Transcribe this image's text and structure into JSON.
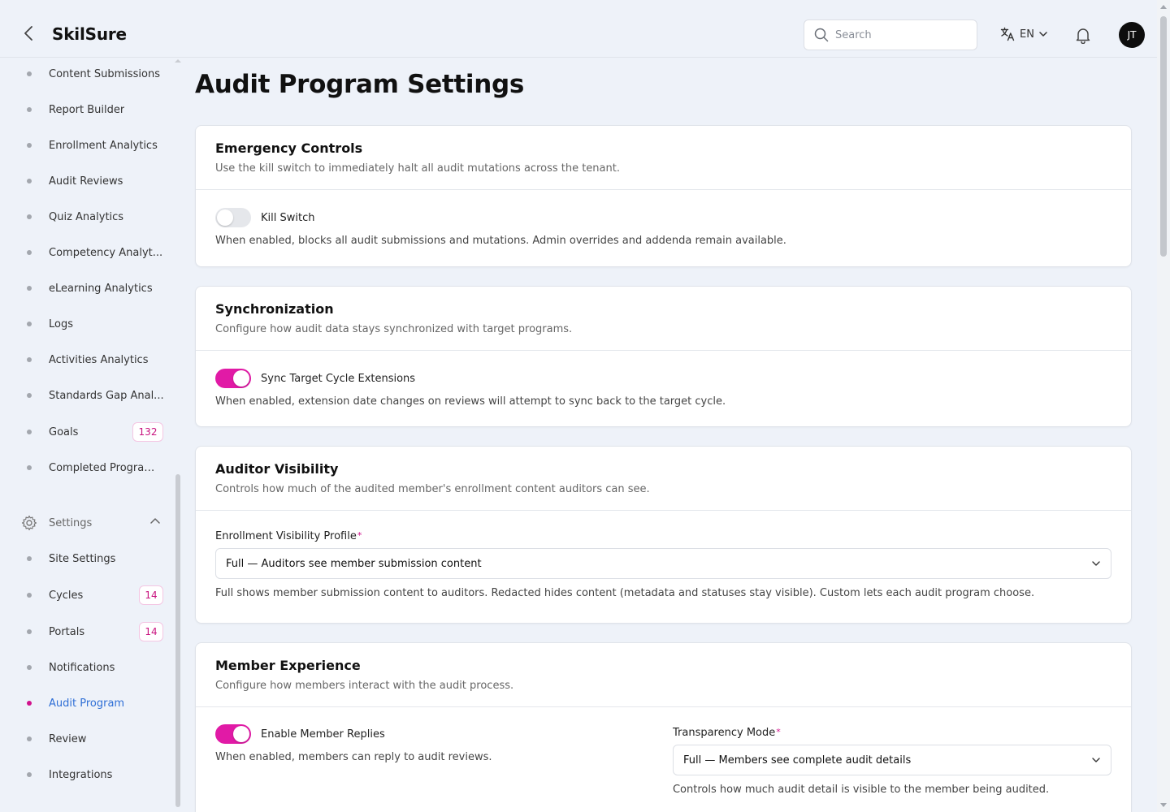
{
  "header": {
    "brand": "SkilSure",
    "search_placeholder": "Search",
    "language": "EN",
    "avatar_initials": "JT"
  },
  "sidebar": {
    "items": [
      {
        "label": "Content Submissions"
      },
      {
        "label": "Report Builder"
      },
      {
        "label": "Enrollment Analytics"
      },
      {
        "label": "Audit Reviews"
      },
      {
        "label": "Quiz Analytics"
      },
      {
        "label": "Competency Analyt..."
      },
      {
        "label": "eLearning Analytics"
      },
      {
        "label": "Logs"
      },
      {
        "label": "Activities Analytics"
      },
      {
        "label": "Standards Gap Anal..."
      },
      {
        "label": "Goals",
        "badge": "132"
      },
      {
        "label": "Completed Program..."
      }
    ],
    "settings_section": "Settings",
    "settings_items": [
      {
        "label": "Site Settings"
      },
      {
        "label": "Cycles",
        "badge": "14"
      },
      {
        "label": "Portals",
        "badge": "14"
      },
      {
        "label": "Notifications"
      },
      {
        "label": "Audit Program",
        "active": true
      },
      {
        "label": "Review"
      },
      {
        "label": "Integrations"
      }
    ]
  },
  "page": {
    "title": "Audit Program Settings"
  },
  "emergency": {
    "title": "Emergency Controls",
    "description": "Use the kill switch to immediately halt all audit mutations across the tenant.",
    "toggle_label": "Kill Switch",
    "toggle_on": false,
    "help": "When enabled, blocks all audit submissions and mutations. Admin overrides and addenda remain available."
  },
  "sync": {
    "title": "Synchronization",
    "description": "Configure how audit data stays synchronized with target programs.",
    "toggle_label": "Sync Target Cycle Extensions",
    "toggle_on": true,
    "help": "When enabled, extension date changes on reviews will attempt to sync back to the target cycle."
  },
  "visibility": {
    "title": "Auditor Visibility",
    "description": "Controls how much of the audited member's enrollment content auditors can see.",
    "field_label": "Enrollment Visibility Profile",
    "required_mark": "*",
    "selected": "Full — Auditors see member submission content",
    "help": "Full shows member submission content to auditors. Redacted hides content (metadata and statuses stay visible). Custom lets each audit program choose."
  },
  "member": {
    "title": "Member Experience",
    "description": "Configure how members interact with the audit process.",
    "toggle_label": "Enable Member Replies",
    "toggle_on": true,
    "help": "When enabled, members can reply to audit reviews.",
    "transparency_label": "Transparency Mode",
    "required_mark": "*",
    "transparency_selected": "Full — Members see complete audit details",
    "transparency_help": "Controls how much audit detail is visible to the member being audited."
  },
  "colors": {
    "accent": "#e11aa6",
    "active_link": "#2f6fd6",
    "badge": "#c8137f"
  }
}
